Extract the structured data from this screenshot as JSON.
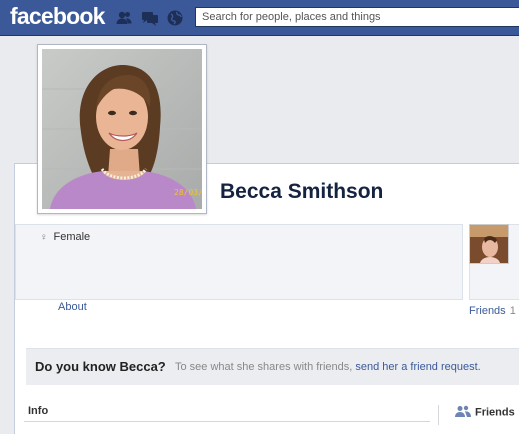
{
  "header": {
    "logo": "facebook",
    "search_placeholder": "Search for people, places and things",
    "jewels": [
      "friend-requests-icon",
      "messages-icon",
      "notifications-globe-icon"
    ]
  },
  "profile": {
    "name": "Becca Smithson",
    "photo_timestamp": "28/03/2",
    "gender": "Female",
    "gender_symbol": "♀",
    "about_label": "About",
    "friends_label": "Friends",
    "friends_count": "1"
  },
  "know_bar": {
    "title": "Do you know Becca?",
    "text": "To see what she shares with friends, ",
    "link": "send her a friend request."
  },
  "sections": {
    "info": "Info",
    "friends": "Friends"
  },
  "colors": {
    "brand": "#3b5998",
    "link": "#3b5998"
  }
}
